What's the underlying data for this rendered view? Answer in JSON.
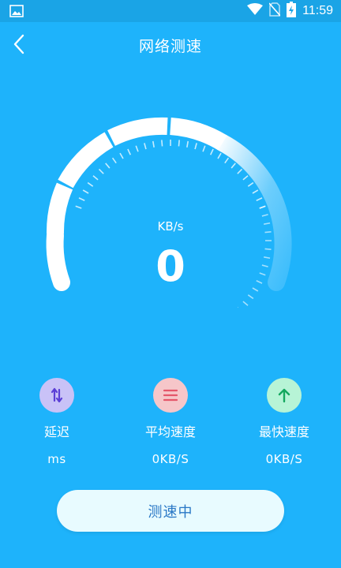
{
  "status_bar": {
    "time": "11:59"
  },
  "app_bar": {
    "title": "网络测速"
  },
  "gauge": {
    "unit": "KB/s",
    "value": "0"
  },
  "stats": [
    {
      "label": "延迟",
      "value": "ms",
      "icon": "latency-arrows-icon",
      "color": "#C9C2F7"
    },
    {
      "label": "平均速度",
      "value": "0KB/S",
      "icon": "menu-lines-icon",
      "color": "#F6C6C9"
    },
    {
      "label": "最快速度",
      "value": "0KB/S",
      "icon": "up-arrow-icon",
      "color": "#B7F4D6"
    }
  ],
  "action_button": {
    "label": "测速中"
  },
  "colors": {
    "background": "#1EB3FB",
    "button_bg": "#E8FBFF",
    "button_text": "#2A78C6"
  }
}
